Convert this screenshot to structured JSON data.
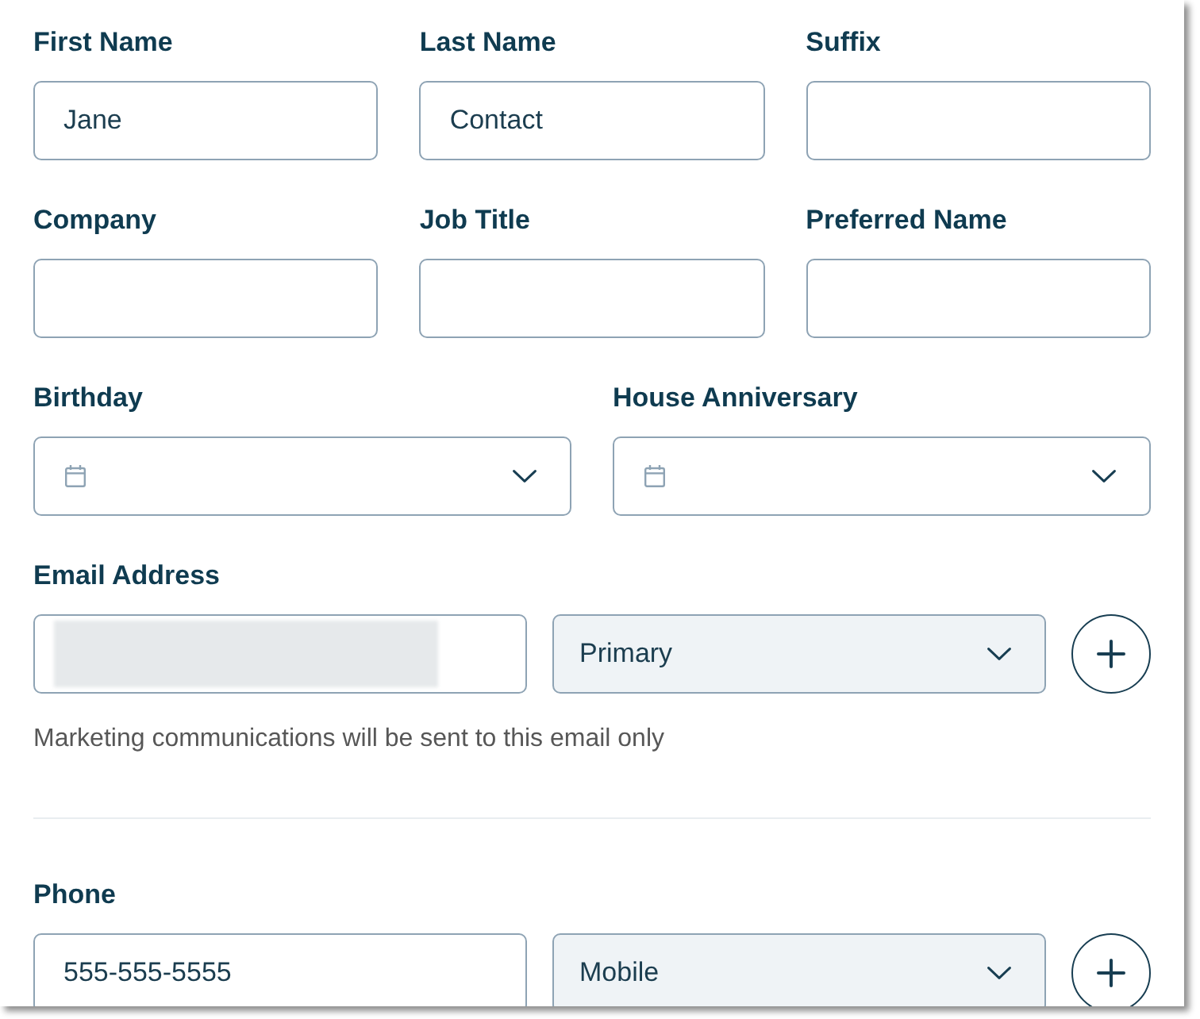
{
  "field_rows": [
    {
      "fields": [
        {
          "kind": "text",
          "label": "First Name",
          "value": "Jane"
        },
        {
          "kind": "text",
          "label": "Last Name",
          "value": "Contact"
        },
        {
          "kind": "text",
          "label": "Suffix"
        }
      ]
    },
    {
      "fields": [
        {
          "kind": "text",
          "label": "Company"
        },
        {
          "kind": "text",
          "label": "Job Title"
        },
        {
          "kind": "text",
          "label": "Preferred Name"
        }
      ]
    },
    {
      "fields": [
        {
          "kind": "date",
          "label": "Birthday"
        },
        {
          "kind": "date",
          "label": "House Anniversary"
        }
      ]
    }
  ],
  "contact_groups": [
    {
      "label": "Email Address",
      "redacted": true,
      "type": "Primary",
      "note": "Marketing communications will be sent to this email only"
    },
    {
      "label": "Phone",
      "redacted": false,
      "value": "555-555-5555",
      "type": "Mobile"
    }
  ]
}
